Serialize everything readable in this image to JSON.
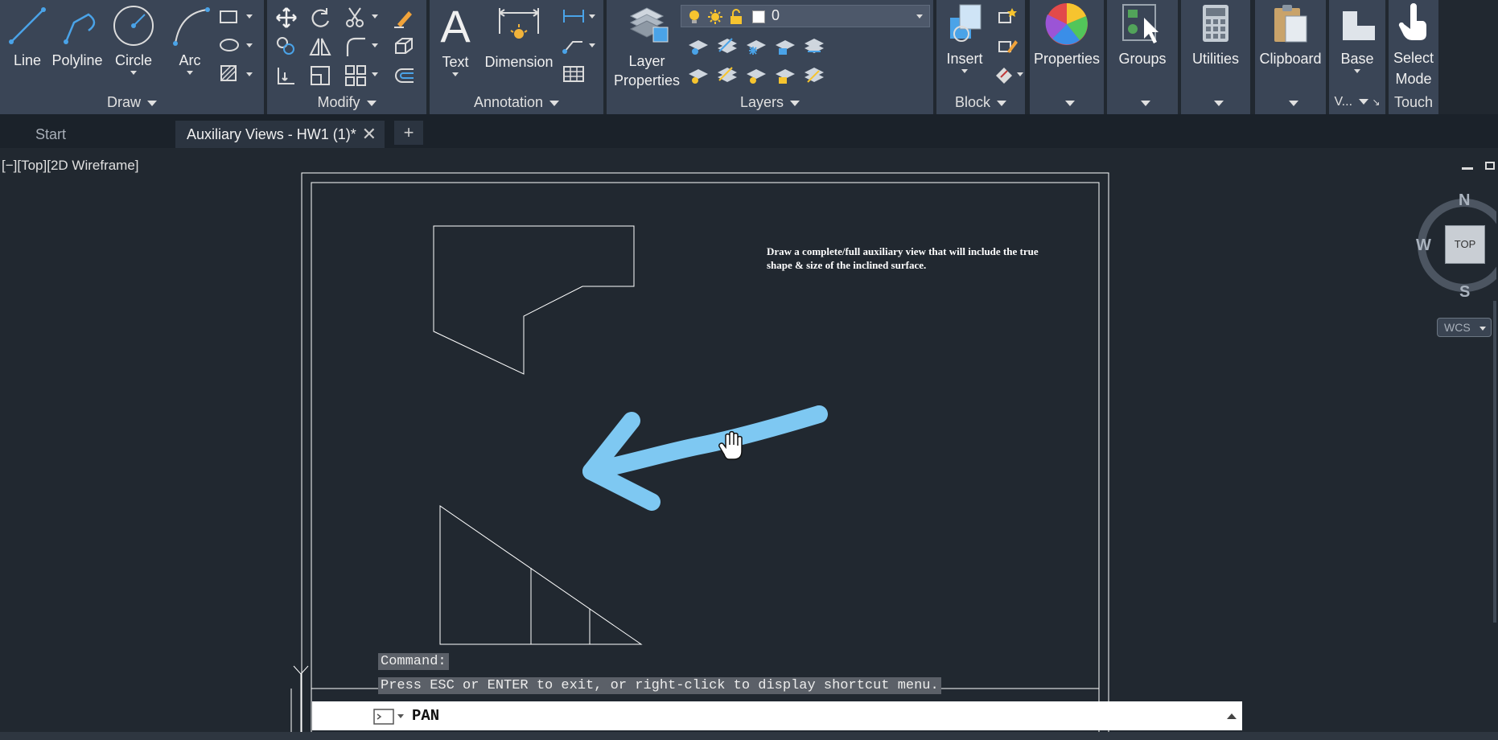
{
  "ribbon": {
    "draw": {
      "title": "Draw",
      "line": "Line",
      "polyline": "Polyline",
      "circle": "Circle",
      "arc": "Arc"
    },
    "modify": {
      "title": "Modify"
    },
    "annotation": {
      "title": "Annotation",
      "text": "Text",
      "dimension": "Dimension"
    },
    "layers": {
      "title": "Layers",
      "layer_properties_1": "Layer",
      "layer_properties_2": "Properties",
      "current_layer": "0"
    },
    "block": {
      "title": "Block",
      "insert": "Insert"
    },
    "properties": {
      "label": "Properties"
    },
    "groups": {
      "label": "Groups"
    },
    "utilities": {
      "label": "Utilities"
    },
    "clipboard": {
      "label": "Clipboard"
    },
    "view": {
      "base": "Base",
      "title": "V..."
    },
    "touch": {
      "select_1": "Select",
      "select_2": "Mode",
      "title": "Touch"
    },
    "icons": [
      "line-icon",
      "polyline-icon",
      "circle-icon",
      "arc-icon",
      "move-icon",
      "rotate-icon",
      "trim-icon",
      "erase-icon",
      "copy-icon",
      "mirror-icon",
      "fillet-icon",
      "explode-icon",
      "stretch-icon",
      "scale-icon",
      "array-icon",
      "offset-icon",
      "text-icon",
      "dimension-icon",
      "table-icon",
      "layer-properties-icon",
      "insert-icon",
      "properties-icon",
      "groups-icon",
      "utilities-icon",
      "clipboard-icon",
      "base-icon",
      "select-mode-icon"
    ]
  },
  "tabs": {
    "start": "Start",
    "active": "Auxiliary Views - HW1 (1)*",
    "close": "✕",
    "new": "+"
  },
  "viewport": {
    "label": "[−][Top][2D Wireframe]"
  },
  "drawing": {
    "note_line1": "Draw a complete/full auxiliary view that will include the true",
    "note_line2": "shape & size of the inclined surface."
  },
  "viewcube": {
    "north": "N",
    "south": "S",
    "west": "W",
    "face": "TOP",
    "ucs": "WCS"
  },
  "command": {
    "history_1": "Command:",
    "history_2": "Press ESC or ENTER to exit, or right-click to display shortcut menu.",
    "current": "PAN"
  },
  "colors": {
    "background": "#212830",
    "ribbon_panel": "#3a4556",
    "arrow_annotation": "#7ec8f2",
    "geometry": "#ffffff"
  }
}
